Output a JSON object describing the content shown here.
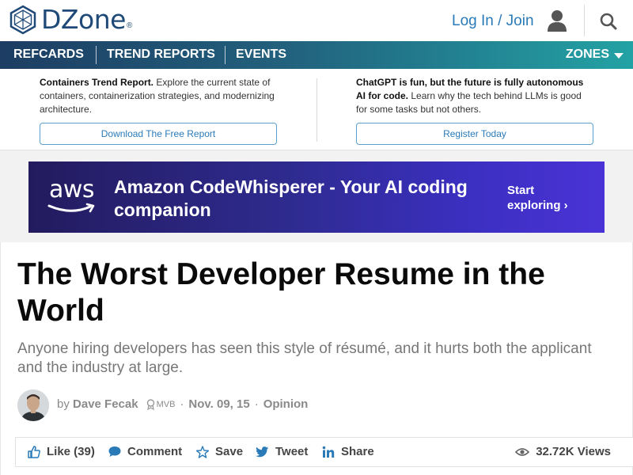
{
  "header": {
    "logo_text": "DZone",
    "logo_mark": "®",
    "login_label": "Log In / Join"
  },
  "nav": {
    "items": [
      "REFCARDS",
      "TREND REPORTS",
      "EVENTS"
    ],
    "zones_label": "ZONES"
  },
  "promos": [
    {
      "bold": "Containers Trend Report.",
      "text": " Explore the current state of containers, containerization strategies, and modernizing architecture.",
      "button": "Download The Free Report"
    },
    {
      "bold": "ChatGPT is fun, but the future is fully autonomous AI for code.",
      "text": " Learn why the tech behind LLMs is good for some tasks but not others.",
      "button": "Register Today"
    }
  ],
  "banner": {
    "brand": "aws",
    "headline": "Amazon CodeWhisperer - Your AI coding companion",
    "cta_line1": "Start",
    "cta_line2": "exploring ›"
  },
  "article": {
    "title": "The Worst Developer Resume in the World",
    "subtitle": "Anyone hiring developers has seen this style of résumé, and it hurts both the applicant and the industry at large.",
    "by": "by",
    "author": "Dave Fecak",
    "badge": "MVB",
    "date": "Nov. 09, 15",
    "category": "Opinion",
    "separator": "·"
  },
  "actions": {
    "like": "Like (39)",
    "comment": "Comment",
    "save": "Save",
    "tweet": "Tweet",
    "share": "Share",
    "views": "32.72K Views"
  },
  "colors": {
    "brand": "#1f4a78",
    "link": "#2a7ab8",
    "nav_start": "#1d3d63",
    "nav_end": "#23a2a4"
  }
}
